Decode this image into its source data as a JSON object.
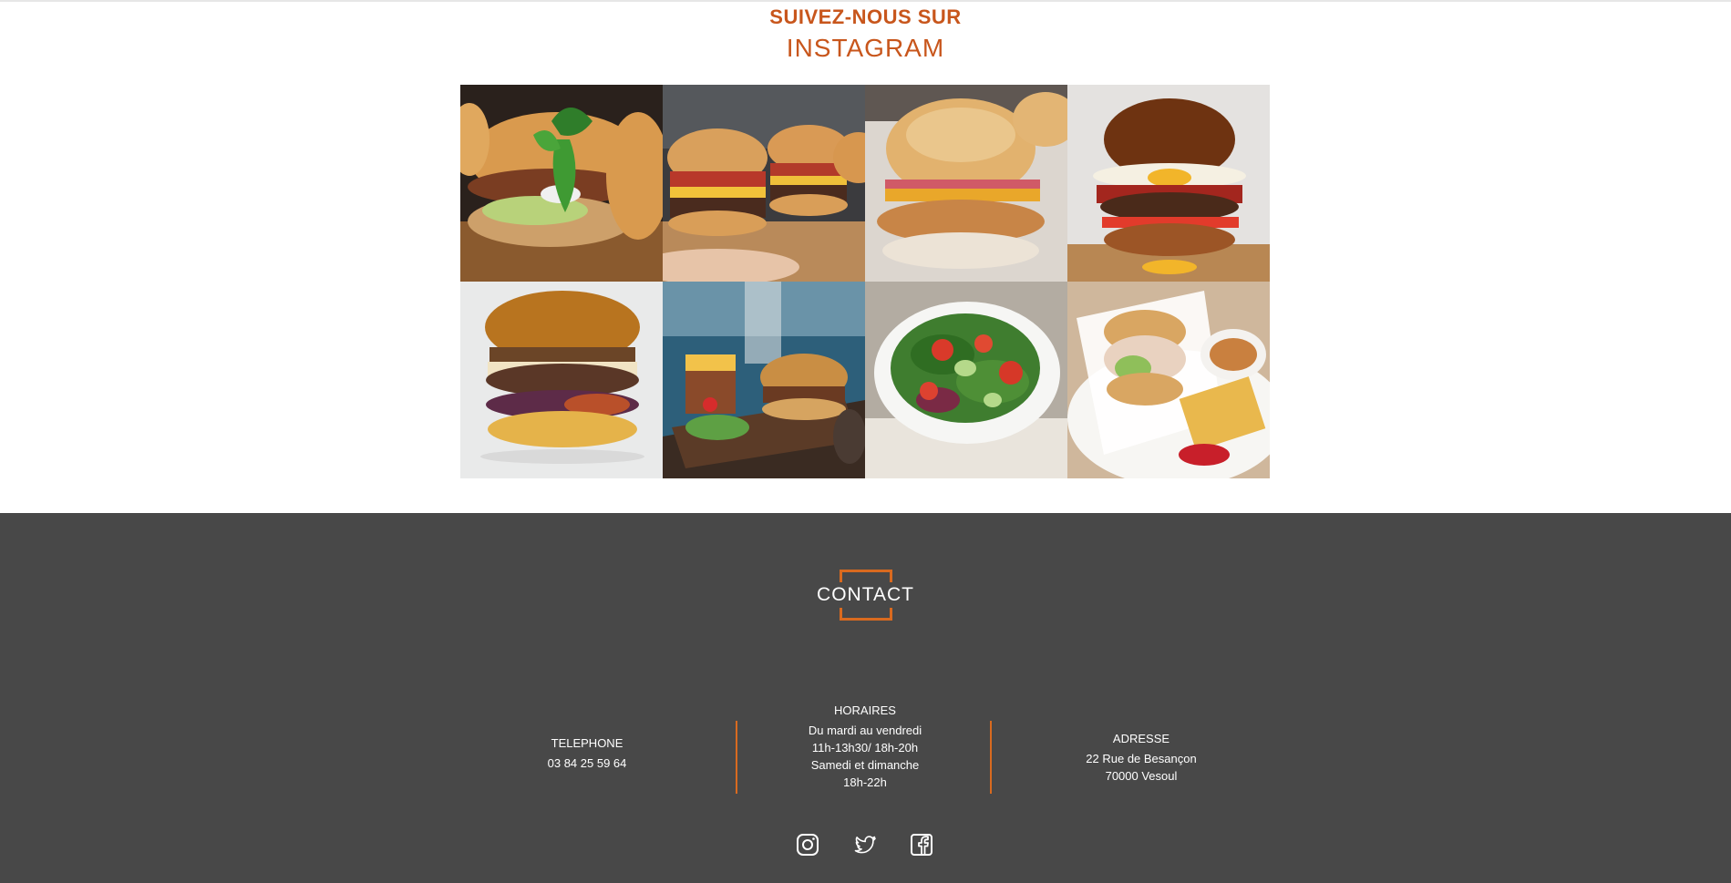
{
  "instagram": {
    "kicker": "SUIVEZ-NOUS SUR",
    "title": "INSTAGRAM",
    "photos": [
      {
        "subject": "burger with basil and lettuce"
      },
      {
        "subject": "three sliders with bacon"
      },
      {
        "subject": "crispy chicken burger with cheese"
      },
      {
        "subject": "pretzel bun burger with fried egg and bacon"
      },
      {
        "subject": "brioche burger with red cabbage"
      },
      {
        "subject": "burger with fries basket on board"
      },
      {
        "subject": "green salad with tomatoes and cucumber"
      },
      {
        "subject": "wrapped burger with waffle fries and ketchup"
      }
    ]
  },
  "contact": {
    "title": "CONTACT",
    "telephone": {
      "heading": "TELEPHONE",
      "number": "03 84 25 59 64"
    },
    "hours": {
      "heading": "HORAIRES",
      "line1": "Du mardi au vendredi",
      "line2": "11h-13h30/ 18h-20h",
      "line3": "Samedi et dimanche",
      "line4": "18h-22h"
    },
    "address": {
      "heading": "ADRESSE",
      "line1": "22 Rue de Besançon",
      "line2": "70000 Vesoul"
    }
  },
  "socials": [
    {
      "icon": "instagram-icon"
    },
    {
      "icon": "twitter-icon"
    },
    {
      "icon": "facebook-icon"
    }
  ],
  "colors": {
    "accent": "#c8561c",
    "accent_line": "#d96a1f",
    "footer_bg": "#484848",
    "text_light": "#ffffff"
  }
}
